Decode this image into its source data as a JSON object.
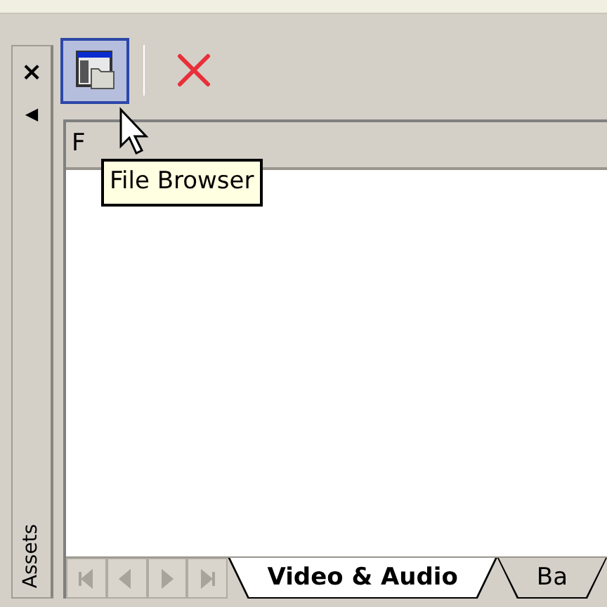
{
  "side_panel": {
    "close": "×",
    "collapse": "◀",
    "title": "Assets"
  },
  "toolbar": {
    "buttons": [
      {
        "kind": "file-browser",
        "selected": true
      },
      {
        "kind": "delete",
        "selected": false
      }
    ]
  },
  "list": {
    "columns": [
      "F"
    ]
  },
  "tooltip": "File Browser",
  "tabs": [
    {
      "label": "Video & Audio",
      "selected": true
    },
    {
      "label": "Ba",
      "selected": false
    }
  ]
}
